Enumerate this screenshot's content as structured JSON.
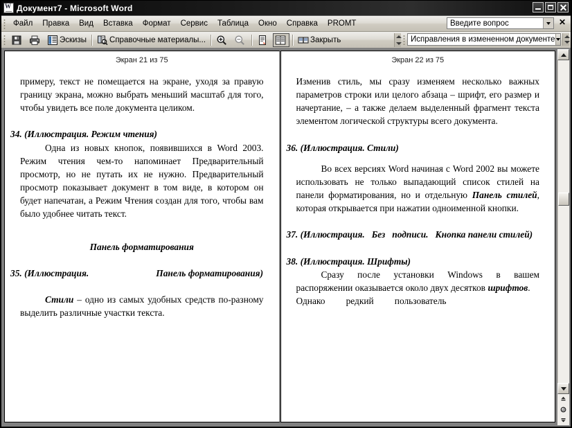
{
  "window": {
    "title": "Документ7 - Microsoft Word",
    "icon": "word-document-icon",
    "minimize_label": "Свернуть",
    "maximize_label": "Развернуть",
    "close_label": "Закрыть"
  },
  "menubar": {
    "items": [
      {
        "label": "Файл",
        "mnemonic": "Ф"
      },
      {
        "label": "Правка",
        "mnemonic": "П"
      },
      {
        "label": "Вид",
        "mnemonic": "и"
      },
      {
        "label": "Вставка",
        "mnemonic": "т"
      },
      {
        "label": "Формат",
        "mnemonic": "м"
      },
      {
        "label": "Сервис",
        "mnemonic": "е"
      },
      {
        "label": "Таблица",
        "mnemonic": "Т"
      },
      {
        "label": "Окно",
        "mnemonic": "О"
      },
      {
        "label": "Справка",
        "mnemonic": "С"
      },
      {
        "label": "PROMT",
        "mnemonic": "P"
      }
    ],
    "ask_box": {
      "value": "Введите вопрос",
      "placeholder": "Введите вопрос",
      "close_glyph": "✕"
    }
  },
  "toolbar": {
    "save_label": "Сохранить",
    "print_label": "Печать",
    "thumbnails_label": "Эскизы",
    "research_label": "Справочные материалы...",
    "zoom_in_label": "Увеличить",
    "zoom_out_label": "Уменьшить",
    "actual_page_label": "Страница целиком",
    "two_pages_label": "Разворот",
    "close_label": "Закрыть",
    "revisions_box": {
      "value": "Исправления в измененном документе"
    }
  },
  "document": {
    "pages": [
      {
        "header": "Экран 21 из 75",
        "blocks": [
          {
            "type": "paragraph",
            "indent": false,
            "text": "примеру, текст не помещается на экране, уходя за правую границу экрана, можно выбрать меньший масштаб для того, чтобы увидеть все поле документа целиком."
          },
          {
            "type": "gap",
            "size": "m"
          },
          {
            "type": "heading",
            "text": "34. (Иллюстрация. Режим чтения)"
          },
          {
            "type": "paragraph",
            "indent": true,
            "text": "Одна из новых кнопок, появившихся в Word 2003. Режим чтения чем-то напоминает Предварительный просмотр, но не путать их не нужно. Предварительный просмотр показывает документ в том виде, в котором он будет напечатан, а Режим Чтения создан для того, чтобы вам было удобнее читать текст."
          },
          {
            "type": "gap",
            "size": "l"
          },
          {
            "type": "heading-center",
            "text": "Панель форматирования"
          },
          {
            "type": "gap",
            "size": "m"
          },
          {
            "type": "heading",
            "text": "35. (Иллюстрация.        Панель форматирования)"
          },
          {
            "type": "gap",
            "size": "m"
          },
          {
            "type": "paragraph-rich",
            "indent": true,
            "lead_bold_italic": "Стили",
            "text": " – одно из самых удобных средств по-разному выделить различные участки текста."
          }
        ]
      },
      {
        "header": "Экран 22 из 75",
        "blocks": [
          {
            "type": "paragraph",
            "indent": false,
            "text": "Изменив стиль, мы сразу изменяем несколько важных параметров строки или целого абзаца – шрифт, его размер и начертание, – а также делаем выделенный фрагмент текста элементом логической структуры всего документа."
          },
          {
            "type": "gap",
            "size": "m"
          },
          {
            "type": "heading",
            "text": "36. (Иллюстрация. Стили)"
          },
          {
            "type": "gap",
            "size": "s"
          },
          {
            "type": "paragraph-rich2",
            "indent": true,
            "text_before": "Во всех версиях Word начиная с Word 2002 вы можете использовать не только выпадающий список стилей на панели форматирования, но и отдельную ",
            "bold_italic": "Панель стилей",
            "text_after": ", которая открывается при нажатии одноименной кнопки."
          },
          {
            "type": "gap",
            "size": "m"
          },
          {
            "type": "heading",
            "text": "37. (Иллюстрация.  Без  подписи.  Кнопка панели стилей)"
          },
          {
            "type": "gap",
            "size": "m"
          },
          {
            "type": "heading",
            "text": "38. (Иллюстрация. Шрифты)"
          },
          {
            "type": "paragraph-rich3",
            "indent": true,
            "text_before": "Сразу после установки Windows в вашем распоряжении оказывается около двух десятков ",
            "bold_italic": "шрифтов",
            "text_after": ".  Однако   редкий   пользователь"
          }
        ]
      }
    ]
  },
  "scrollbar": {
    "up_label": "Прокрутка вверх",
    "down_label": "Прокрутка вниз",
    "prev_page_label": "Предыдущая страница",
    "select_object_label": "Выбор объекта перехода",
    "next_page_label": "Следующая страница",
    "thumb_top_percent": 41,
    "thumb_height_percent": 4
  },
  "colors": {
    "titlebar": "#0b0b0b",
    "chrome": "#d4d0c8",
    "doc_background": "#808080",
    "page": "#ffffff",
    "text": "#000000"
  }
}
